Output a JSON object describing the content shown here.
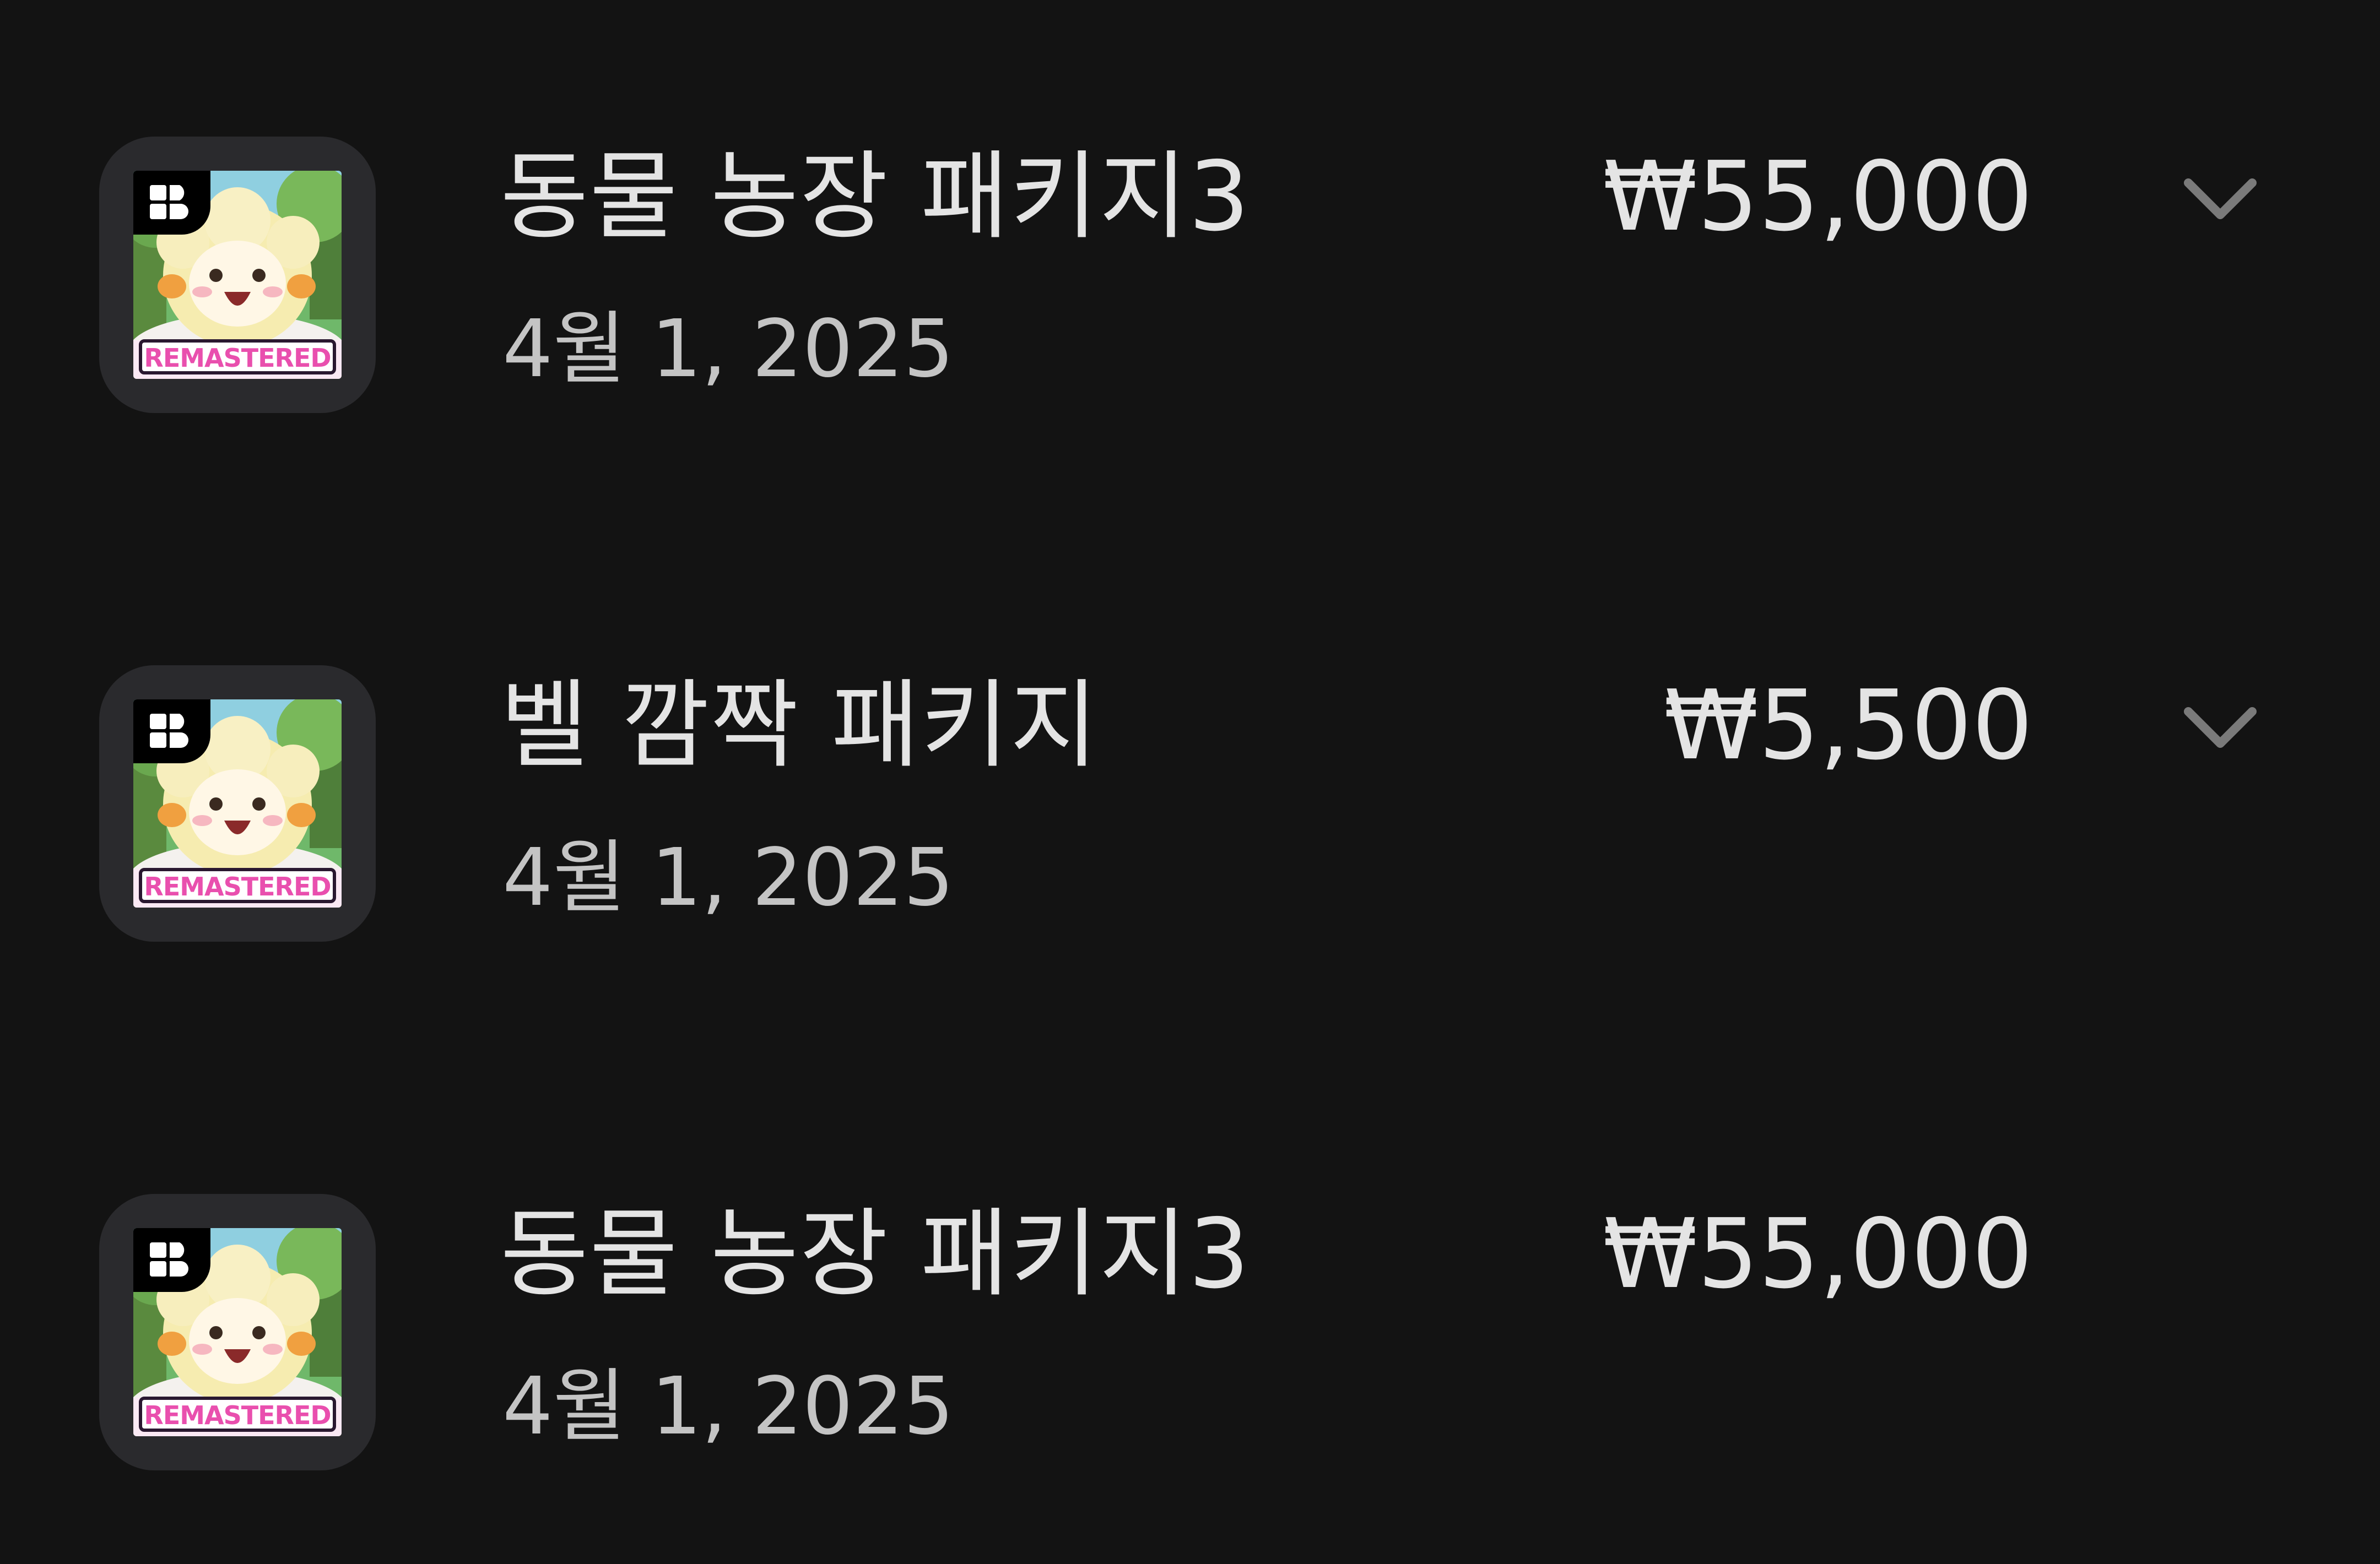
{
  "purchases": [
    {
      "title": "동물 농장 패키지3",
      "date": "4월 1, 2025",
      "price": "₩55,000",
      "icon": "game-icon-remastered",
      "has_expand": true
    },
    {
      "title": "벨 깜짝 패키지",
      "date": "4월 1, 2025",
      "price": "₩5,500",
      "icon": "game-icon-remastered",
      "has_expand": true
    },
    {
      "title": "동물 농장 패키지3",
      "date": "4월 1, 2025",
      "price": "₩55,000",
      "icon": "game-icon-remastered",
      "has_expand": false
    }
  ],
  "icon_badge_text": "REMASTERED",
  "colors": {
    "background": "#131313",
    "primary_text": "#e4e4e4",
    "secondary_text": "#c4c4c4",
    "icon_tile": "#2a2a2d",
    "chevron": "#7a7a7a",
    "badge_pink": "#e94fae"
  }
}
